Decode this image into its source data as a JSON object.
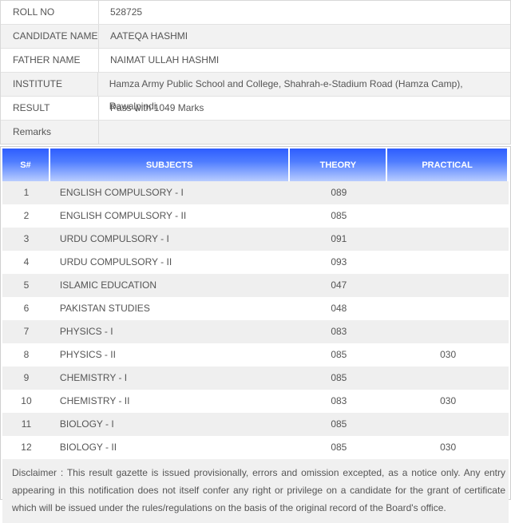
{
  "candidate": [
    {
      "label": "ROLL NO",
      "value": "528725"
    },
    {
      "label": "CANDIDATE NAME",
      "value": "AATEQA HASHMI"
    },
    {
      "label": "FATHER NAME",
      "value": "NAIMAT ULLAH HASHMI"
    },
    {
      "label": "INSTITUTE",
      "value": "Hamza Army Public School and College, Shahrah-e-Stadium Road (Hamza Camp), Rawalpindi."
    },
    {
      "label": "RESULT",
      "value": "Pass with 1049 Marks"
    },
    {
      "label": "Remarks",
      "value": ""
    }
  ],
  "table": {
    "headers": {
      "sno": "S#",
      "subjects": "SUBJECTS",
      "theory": "THEORY",
      "practical": "PRACTICAL"
    },
    "rows": [
      {
        "sno": "1",
        "subject": "ENGLISH COMPULSORY - I",
        "theory": "089",
        "practical": ""
      },
      {
        "sno": "2",
        "subject": "ENGLISH COMPULSORY - II",
        "theory": "085",
        "practical": ""
      },
      {
        "sno": "3",
        "subject": "URDU COMPULSORY - I",
        "theory": "091",
        "practical": ""
      },
      {
        "sno": "4",
        "subject": "URDU COMPULSORY - II",
        "theory": "093",
        "practical": ""
      },
      {
        "sno": "5",
        "subject": "ISLAMIC EDUCATION",
        "theory": "047",
        "practical": ""
      },
      {
        "sno": "6",
        "subject": "PAKISTAN STUDIES",
        "theory": "048",
        "practical": ""
      },
      {
        "sno": "7",
        "subject": "PHYSICS - I",
        "theory": "083",
        "practical": ""
      },
      {
        "sno": "8",
        "subject": "PHYSICS - II",
        "theory": "085",
        "practical": "030"
      },
      {
        "sno": "9",
        "subject": "CHEMISTRY - I",
        "theory": "085",
        "practical": ""
      },
      {
        "sno": "10",
        "subject": "CHEMISTRY - II",
        "theory": "083",
        "practical": "030"
      },
      {
        "sno": "11",
        "subject": "BIOLOGY - I",
        "theory": "085",
        "practical": ""
      },
      {
        "sno": "12",
        "subject": "BIOLOGY - II",
        "theory": "085",
        "practical": "030"
      }
    ]
  },
  "disclaimer": "Disclaimer : This result gazette is issued provisionally, errors and omission excepted, as a notice only. Any entry appearing in this notification does not itself confer any right or privilege on a candidate for the grant of certificate which will be issued under the rules/regulations on the basis of the original record of the Board's office.",
  "colors": {
    "header_blue": "#2e5dff",
    "row_stripe": "#efefef"
  }
}
